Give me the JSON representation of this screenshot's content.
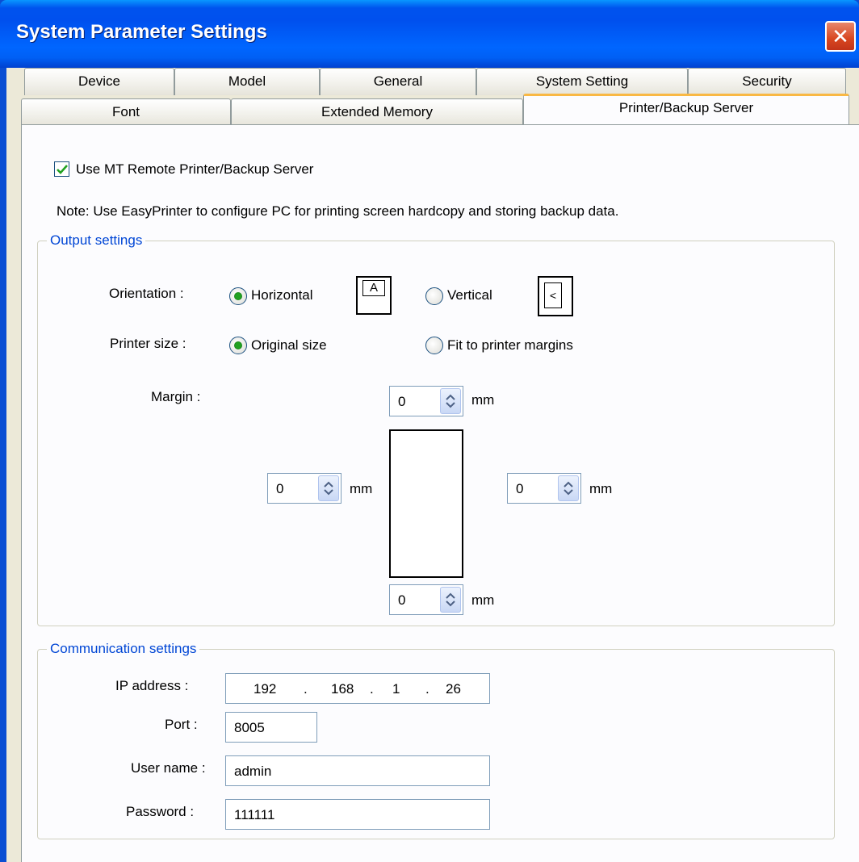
{
  "window": {
    "title": "System Parameter Settings"
  },
  "tabs": {
    "row1": [
      "Device",
      "Model",
      "General",
      "System Setting",
      "Security"
    ],
    "row2": [
      "Font",
      "Extended Memory",
      "Printer/Backup Server"
    ],
    "active": "Printer/Backup Server"
  },
  "use_remote": {
    "label": "Use MT Remote Printer/Backup Server",
    "checked": true
  },
  "note": "Note: Use EasyPrinter to configure PC for printing screen hardcopy and storing backup data.",
  "output": {
    "title": "Output settings",
    "orientation_label": "Orientation :",
    "horizontal_label": "Horizontal",
    "vertical_label": "Vertical",
    "orientation_value": "Horizontal",
    "icon_letter": "A",
    "printer_size_label": "Printer size :",
    "original_size_label": "Original size",
    "fit_label": "Fit to printer margins",
    "printer_size_value": "Original size",
    "margin_label": "Margin :",
    "margin_top": "0",
    "margin_left": "0",
    "margin_right": "0",
    "margin_bottom": "0",
    "unit": "mm"
  },
  "comm": {
    "title": "Communication settings",
    "ip_label": "IP address :",
    "ip": [
      "192",
      "168",
      "1",
      "26"
    ],
    "ip_dot": ".",
    "port_label": "Port :",
    "port": "8005",
    "user_label": "User name :",
    "user": "admin",
    "password_label": "Password :",
    "password": "111111"
  }
}
